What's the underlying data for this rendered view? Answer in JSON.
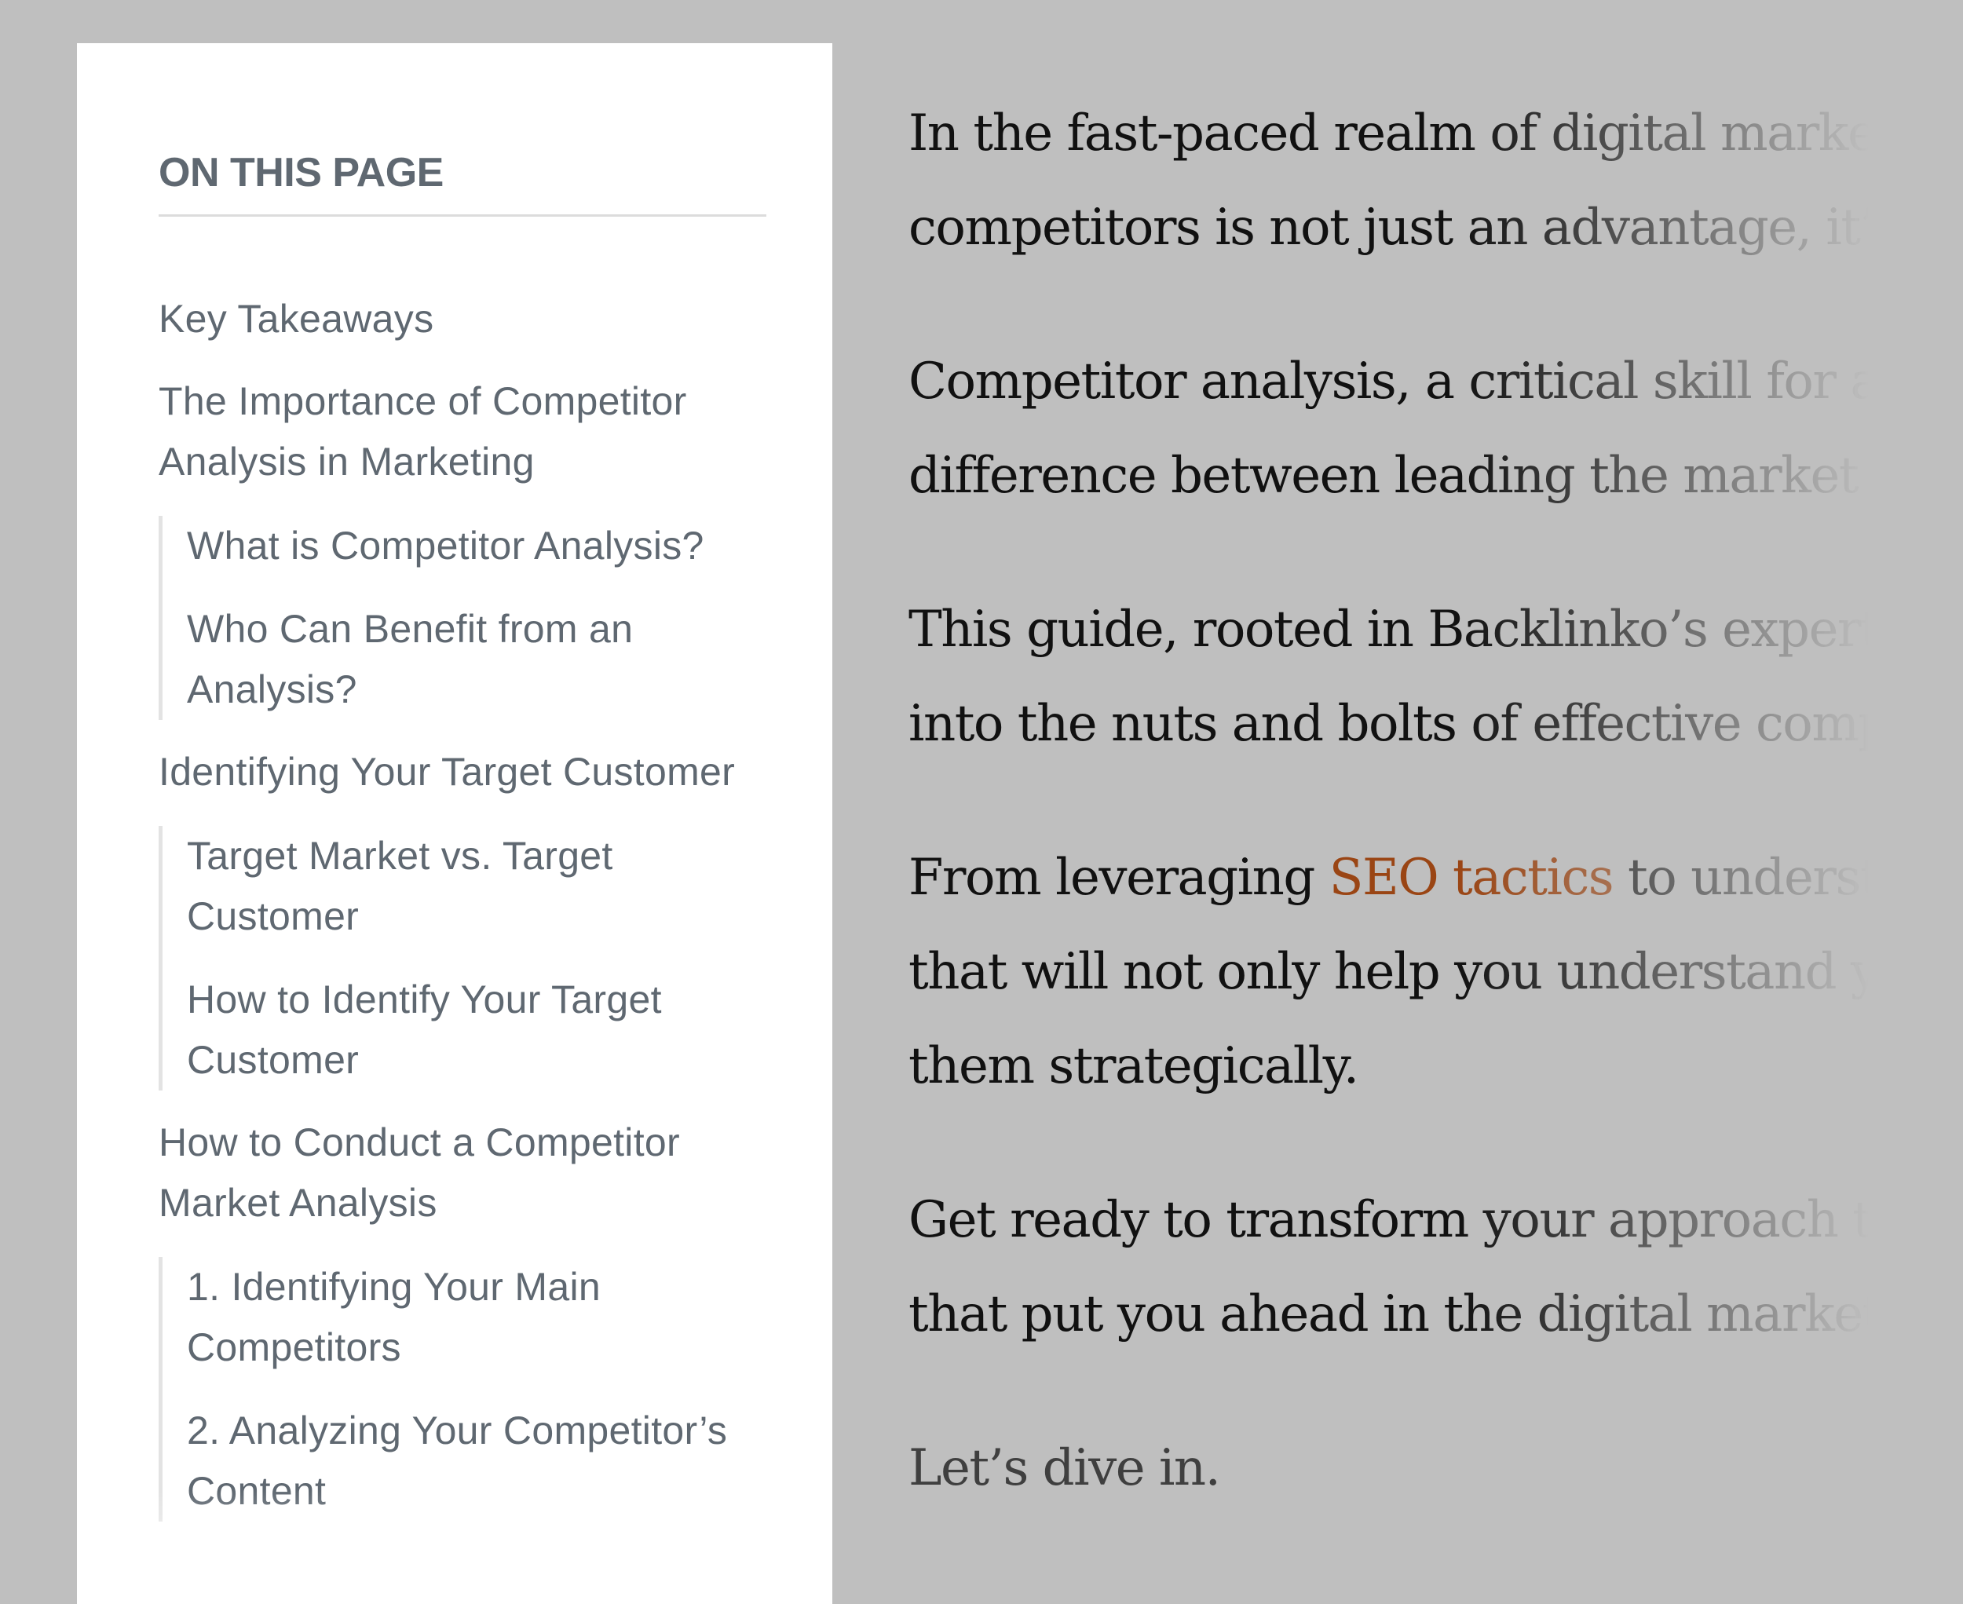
{
  "toc": {
    "title": "ON THIS PAGE",
    "items": [
      {
        "label": "Key Takeaways",
        "children": []
      },
      {
        "label": "The Importance of Competitor Analysis in Marketing",
        "children": [
          {
            "label": "What is Competitor Analysis?"
          },
          {
            "label": "Who Can Benefit from an Analysis?"
          }
        ]
      },
      {
        "label": "Identifying Your Target Customer",
        "children": [
          {
            "label": "Target Market vs. Target Customer"
          },
          {
            "label": "How to Identify Your Target Customer"
          }
        ]
      },
      {
        "label": "How to Conduct a Competitor Market Analysis",
        "children": [
          {
            "label": "1. Identifying Your Main Competitors"
          },
          {
            "label": "2. Analyzing Your Competitor’s Content"
          }
        ]
      }
    ]
  },
  "article": {
    "paragraphs": [
      {
        "lines": [
          "In the fast-paced realm of digital marketi",
          "competitors is not just an advantage, it’s a"
        ]
      },
      {
        "lines": [
          "Competitor analysis, a critical skill for any",
          "difference between leading the market or"
        ]
      },
      {
        "lines": [
          "This guide, rooted in Backlinko’s expert a",
          "into the nuts and bolts of effective compe"
        ]
      },
      {
        "line1_before": "From leveraging ",
        "link": "SEO tactics",
        "line1_after": " to understan",
        "lines_rest": [
          "that will not only help you understand yo",
          "them strategically."
        ]
      },
      {
        "lines": [
          "Get ready to transform your approach to c",
          "that put you ahead in the digital marketin"
        ]
      },
      {
        "lines": [
          "Let’s dive in."
        ]
      }
    ],
    "link_color": "#9a4514"
  }
}
